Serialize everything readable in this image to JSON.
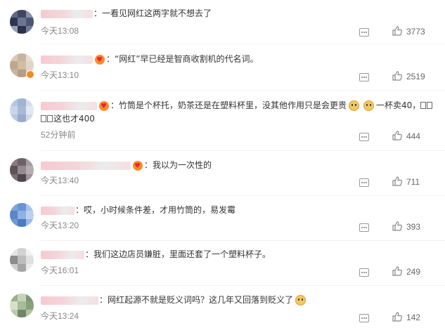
{
  "comments": [
    {
      "name_blur_width": 74,
      "fans_badge": false,
      "verified_badge": false,
      "text": "一看见网红这两字就不想去了",
      "time": "今天13:08",
      "likes": "3773",
      "avatar_colors": [
        "#5f6a86",
        "#3e4761",
        "#8a8fa6",
        "#2f3650",
        "#6b7593",
        "#4b5470",
        "#98a0b8",
        "#2b3148",
        "#717b97"
      ]
    },
    {
      "name_blur_width": 74,
      "fans_badge": true,
      "verified_badge": true,
      "text": "“网红”早已经是智商收割机的代名词。",
      "time": "今天13:10",
      "likes": "2519",
      "avatar_colors": [
        "#d9c8b6",
        "#c7b39e",
        "#e8ddd1",
        "#bfa78f",
        "#d1bca6",
        "#e3d5c6",
        "#c9b49f",
        "#b69d84",
        "#ddcfbf"
      ]
    },
    {
      "name_blur_width": 80,
      "fans_badge": true,
      "verified_badge": false,
      "text_before_emoji1": "竹筒是个杯托，奶茶还是在塑料杯里，没其他作用只是会更贵",
      "text_after_emoji2": "一杯卖40，",
      "text_line2": "这也才400",
      "time": "52分钟前",
      "likes": "444",
      "avatar_colors": [
        "#b5c6e0",
        "#9fb3d3",
        "#d4dde9",
        "#c9d6e8",
        "#a7b9d7",
        "#e2e8f0",
        "#b9c8de",
        "#98abcb",
        "#d0dae8"
      ]
    },
    {
      "name_blur_width": 128,
      "fans_badge": true,
      "verified_badge": false,
      "text": "我以为一次性的",
      "time": "今天13:40",
      "likes": "711",
      "avatar_colors": [
        "#8a7c82",
        "#6e6268",
        "#a89ca1",
        "#5c5258",
        "#978a90",
        "#b6adb1",
        "#7b6f75",
        "#4f464b",
        "#a1959a"
      ]
    },
    {
      "name_blur_width": 48,
      "fans_badge": false,
      "verified_badge": false,
      "text": "哎，小时候条件差，才用竹筒的，易发霉",
      "time": "今天13:20",
      "likes": "393",
      "avatar_colors": [
        "#7ea6de",
        "#6a94d2",
        "#a9c3ea",
        "#5a86c8",
        "#8fb1e3",
        "#bcd0ee",
        "#7099d6",
        "#4e7bc0",
        "#9ab9e6"
      ]
    },
    {
      "name_blur_width": 62,
      "fans_badge": false,
      "verified_badge": false,
      "text": "我们这边店员嫌脏，里面还套了一个塑料杯子。",
      "time": "今天16:01",
      "likes": "249",
      "avatar_colors": [
        "#e5e5e5",
        "#d2d2d2",
        "#f0f0f0",
        "#8c8c8c",
        "#bdbdbd",
        "#e0e0e0",
        "#cfcfcf",
        "#a5a5a5",
        "#ececec"
      ]
    },
    {
      "name_blur_width": 82,
      "fans_badge": false,
      "verified_badge": false,
      "text": "网红起源不就是贬义词吗？这几年又回落到贬义了",
      "time": "今天13:24",
      "likes": "142",
      "avatar_colors": [
        "#9bb08e",
        "#c6d3b9",
        "#7f9673",
        "#d7e0cd",
        "#a8bb9a",
        "#8aa07d",
        "#bccbad",
        "#6f8765",
        "#b1c2a3"
      ]
    }
  ],
  "colors": {
    "time_gray": "#888888",
    "text": "#333333",
    "icon_gray": "#999999"
  },
  "icons": {
    "reply": "comment-icon",
    "like": "thumbs-up-icon",
    "fans": "fans-badge-icon",
    "emoji": "doge-emoji-icon"
  }
}
